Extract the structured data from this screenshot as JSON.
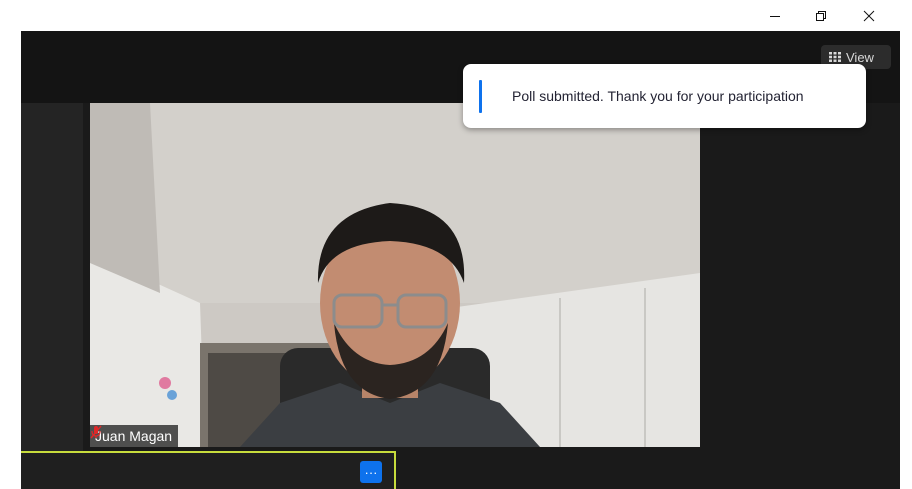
{
  "window": {
    "controls": [
      {
        "name": "minimize",
        "icon": "minimize-icon"
      },
      {
        "name": "restore",
        "icon": "restore-icon"
      },
      {
        "name": "close",
        "icon": "close-icon"
      }
    ]
  },
  "toolbar": {
    "view_label": "View",
    "view_icon": "grid-icon"
  },
  "notification": {
    "message": "Poll submitted. Thank you for your participation",
    "accent_color": "#0e72ed"
  },
  "participant": {
    "name": "Juan Magan",
    "muted": true,
    "mic_icon": "muted-mic-icon"
  },
  "self_view": {
    "more_label": "···",
    "more_icon": "more-options-icon",
    "active_speaker_color": "#c7dc3c"
  }
}
